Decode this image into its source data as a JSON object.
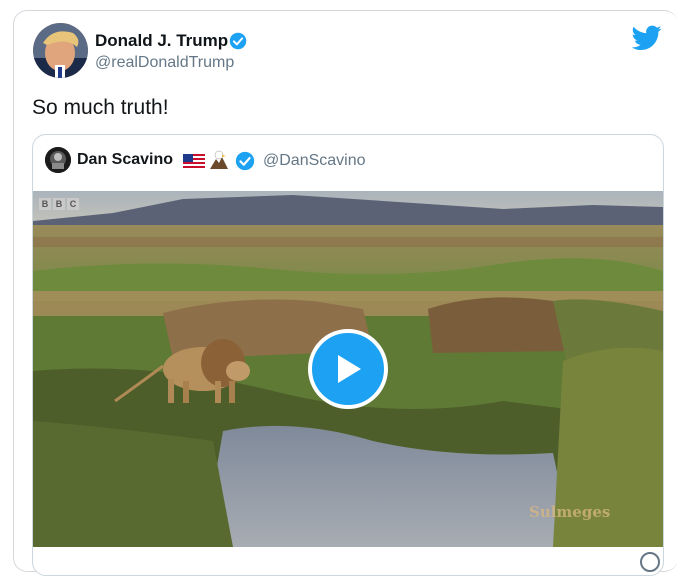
{
  "tweet": {
    "author_name": "Donald J. Trump",
    "author_handle": "@realDonaldTrump",
    "text": "So much truth!",
    "verified": true
  },
  "quoted_tweet": {
    "author_name": "Dan Scavino",
    "author_handle": "@DanScavino",
    "verified": true,
    "name_emojis": [
      "us-flag-icon",
      "eagle-icon"
    ]
  },
  "media": {
    "type": "video",
    "broadcaster_logo_letters": [
      "B",
      "B",
      "C"
    ],
    "watermark": "Sulmeges",
    "play_icon": "play-icon"
  },
  "colors": {
    "accent": "#1da1f2",
    "text": "#14171a",
    "muted": "#657786",
    "border": "#ccd6dd"
  }
}
